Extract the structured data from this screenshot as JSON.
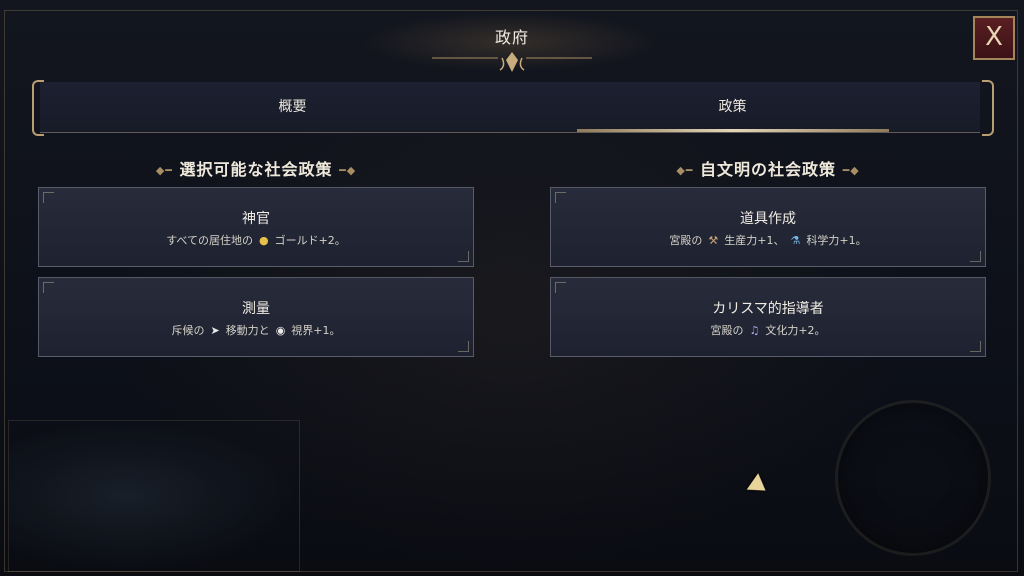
{
  "window": {
    "title": "政府",
    "close_label": "X"
  },
  "tabs": [
    {
      "label": "概要",
      "active": false
    },
    {
      "label": "政策",
      "active": true
    }
  ],
  "sections": {
    "available": {
      "heading": "選択可能な社会政策",
      "cards": [
        {
          "title": "神官",
          "desc_before": "すべての居住地の",
          "icon1": "gold-icon",
          "desc_after": "ゴールド+2。"
        },
        {
          "title": "測量",
          "desc_before": "斥候の",
          "icon1": "movement-icon",
          "desc_middle": "移動力と",
          "icon2": "sight-icon",
          "desc_after": "視界+1。"
        }
      ]
    },
    "own_civ": {
      "heading": "自文明の社会政策",
      "cards": [
        {
          "title": "道具作成",
          "desc_before": "宮殿の",
          "icon1": "hammer-icon",
          "desc_middle": "生産力+1、",
          "icon2": "flask-icon",
          "desc_after": "科学力+1。"
        },
        {
          "title": "カリスマ的指導者",
          "desc_before": "宮殿の",
          "icon1": "music-note-icon",
          "desc_after": "文化力+2。"
        }
      ]
    }
  },
  "colors": {
    "accent_gold": "#b99e72",
    "close_red": "#5a1f22"
  }
}
